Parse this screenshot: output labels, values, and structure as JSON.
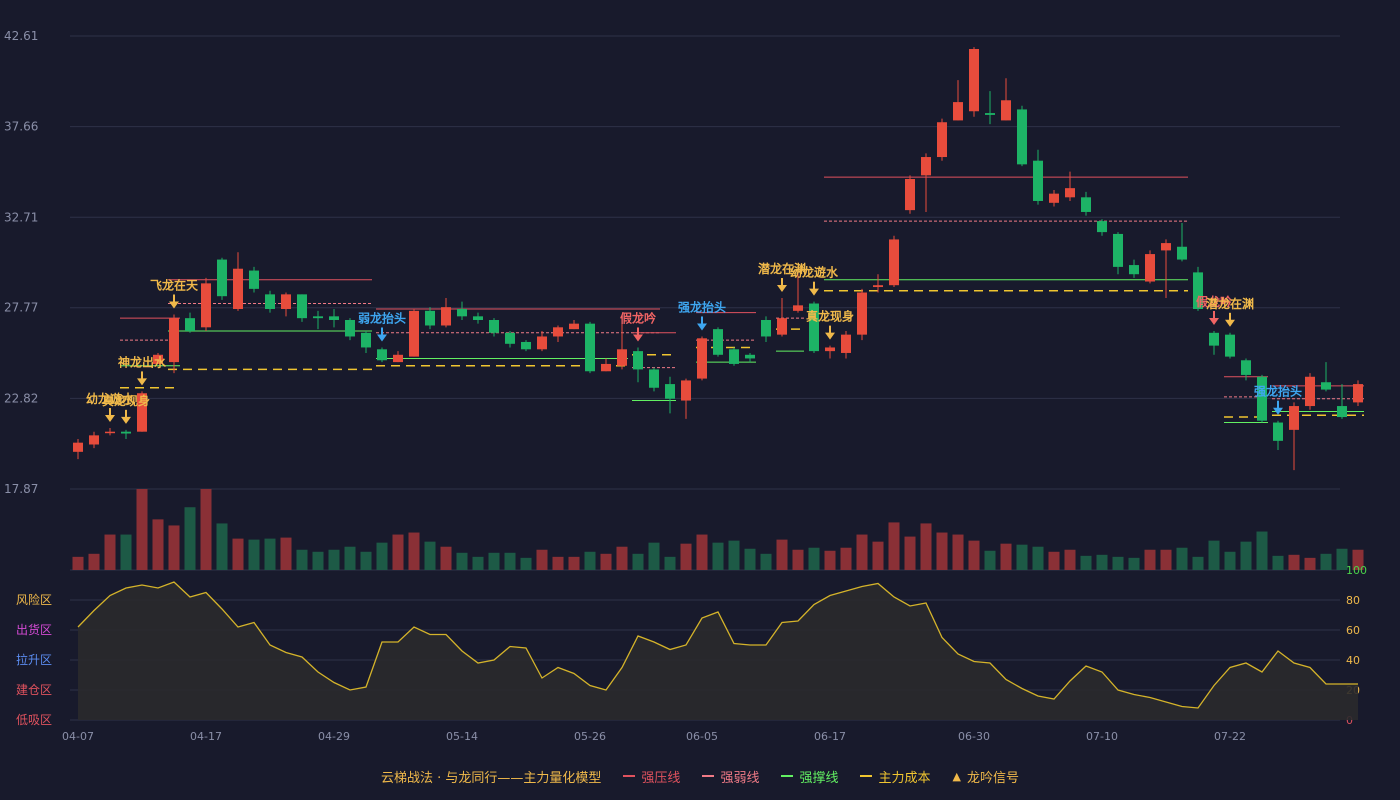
{
  "chart_data": {
    "type": "candlestick",
    "dates": [
      "04-07",
      "04-08",
      "04-09",
      "04-10",
      "04-11",
      "04-14",
      "04-15",
      "04-16",
      "04-17",
      "04-18",
      "04-21",
      "04-22",
      "04-23",
      "04-24",
      "04-25",
      "04-28",
      "04-29",
      "04-30",
      "05-06",
      "05-07",
      "05-08",
      "05-09",
      "05-12",
      "05-13",
      "05-14",
      "05-15",
      "05-16",
      "05-19",
      "05-20",
      "05-21",
      "05-22",
      "05-23",
      "05-26",
      "05-27",
      "05-28",
      "05-29",
      "05-30",
      "06-03",
      "06-04",
      "06-05",
      "06-06",
      "06-09",
      "06-10",
      "06-11",
      "06-12",
      "06-13",
      "06-16",
      "06-17",
      "06-18",
      "06-19",
      "06-20",
      "06-23",
      "06-24",
      "06-25",
      "06-26",
      "06-27",
      "06-30",
      "07-01",
      "07-02",
      "07-03",
      "07-04",
      "07-07",
      "07-08",
      "07-09",
      "07-10",
      "07-11",
      "07-14",
      "07-15",
      "07-16",
      "07-17",
      "07-18",
      "07-21",
      "07-22",
      "07-23",
      "07-24",
      "07-25",
      "07-28",
      "07-29",
      "07-30",
      "07-31",
      "08-01"
    ],
    "x_ticks": [
      "04-07",
      "04-17",
      "04-29",
      "05-14",
      "05-26",
      "06-05",
      "06-17",
      "06-30",
      "07-10",
      "07-22"
    ],
    "price_ticks": [
      "42.61",
      "37.66",
      "32.71",
      "27.77",
      "22.82",
      "17.87"
    ],
    "price_range": [
      17.87,
      42.61
    ],
    "ohlc": [
      [
        19.9,
        20.4,
        19.5,
        20.6
      ],
      [
        20.3,
        20.8,
        20.1,
        21.0
      ],
      [
        21.0,
        21.0,
        20.8,
        21.2
      ],
      [
        21.0,
        20.9,
        20.6,
        21.1
      ],
      [
        21.0,
        23.1,
        21.0,
        23.2
      ],
      [
        24.7,
        25.2,
        24.7,
        25.3
      ],
      [
        24.8,
        27.2,
        24.2,
        27.4
      ],
      [
        27.2,
        26.5,
        26.4,
        27.5
      ],
      [
        26.7,
        29.1,
        26.5,
        29.4
      ],
      [
        30.4,
        28.4,
        28.2,
        30.5
      ],
      [
        27.7,
        29.9,
        27.6,
        30.8
      ],
      [
        29.8,
        28.8,
        28.6,
        30.0
      ],
      [
        28.5,
        27.7,
        27.5,
        28.7
      ],
      [
        27.7,
        28.5,
        27.3,
        28.6
      ],
      [
        28.5,
        27.2,
        27.0,
        28.5
      ],
      [
        27.3,
        27.2,
        26.6,
        27.6
      ],
      [
        27.3,
        27.1,
        26.7,
        27.7
      ],
      [
        27.1,
        26.2,
        26.0,
        27.2
      ],
      [
        26.4,
        25.6,
        25.3,
        26.5
      ],
      [
        25.5,
        24.9,
        24.8,
        25.6
      ],
      [
        24.8,
        25.2,
        24.8,
        25.4
      ],
      [
        25.1,
        27.6,
        25.1,
        27.7
      ],
      [
        27.6,
        26.8,
        26.6,
        27.8
      ],
      [
        26.8,
        27.8,
        26.7,
        28.3
      ],
      [
        27.7,
        27.3,
        27.1,
        28.1
      ],
      [
        27.3,
        27.1,
        26.9,
        27.5
      ],
      [
        27.1,
        26.4,
        26.2,
        27.2
      ],
      [
        26.4,
        25.8,
        25.6,
        26.5
      ],
      [
        25.9,
        25.5,
        25.4,
        26.0
      ],
      [
        25.5,
        26.2,
        25.4,
        26.5
      ],
      [
        26.2,
        26.7,
        25.9,
        26.8
      ],
      [
        26.6,
        26.9,
        26.6,
        27.1
      ],
      [
        26.9,
        24.3,
        24.2,
        27.0
      ],
      [
        24.3,
        24.7,
        24.3,
        25.0
      ],
      [
        24.6,
        25.5,
        24.4,
        27.0
      ],
      [
        25.4,
        24.4,
        23.7,
        25.6
      ],
      [
        24.4,
        23.4,
        23.2,
        24.5
      ],
      [
        23.6,
        22.8,
        22.0,
        24.0
      ],
      [
        22.7,
        23.8,
        21.7,
        23.9
      ],
      [
        23.9,
        26.1,
        23.8,
        26.2
      ],
      [
        26.6,
        25.2,
        25.1,
        26.7
      ],
      [
        25.5,
        24.7,
        24.6,
        25.6
      ],
      [
        25.2,
        25.0,
        24.8,
        25.3
      ],
      [
        27.1,
        26.2,
        25.9,
        27.3
      ],
      [
        26.3,
        27.2,
        26.2,
        28.3
      ],
      [
        27.6,
        27.9,
        27.5,
        29.9
      ],
      [
        28.0,
        25.4,
        25.3,
        28.1
      ],
      [
        25.4,
        25.6,
        25.0,
        25.7
      ],
      [
        25.3,
        26.3,
        25.0,
        26.5
      ],
      [
        26.3,
        28.6,
        26.0,
        28.8
      ],
      [
        28.9,
        29.0,
        28.6,
        29.6
      ],
      [
        29.0,
        31.5,
        28.9,
        31.7
      ],
      [
        33.1,
        34.8,
        32.9,
        35.0
      ],
      [
        35.0,
        36.0,
        33.0,
        36.2
      ],
      [
        36.0,
        37.9,
        35.8,
        38.1
      ],
      [
        38.0,
        39.0,
        38.0,
        40.2
      ],
      [
        38.5,
        41.9,
        38.2,
        42.0
      ],
      [
        38.4,
        38.3,
        37.8,
        39.6
      ],
      [
        38.0,
        39.1,
        38.0,
        40.3
      ],
      [
        38.6,
        35.6,
        35.5,
        38.8
      ],
      [
        35.8,
        33.6,
        33.4,
        36.4
      ],
      [
        33.5,
        34.0,
        33.3,
        34.2
      ],
      [
        33.8,
        34.3,
        33.6,
        35.2
      ],
      [
        33.8,
        33.0,
        32.8,
        34.1
      ],
      [
        32.5,
        31.9,
        31.7,
        32.6
      ],
      [
        31.8,
        30.0,
        29.6,
        31.9
      ],
      [
        30.1,
        29.6,
        29.4,
        30.4
      ],
      [
        29.2,
        30.7,
        29.1,
        30.9
      ],
      [
        30.9,
        31.3,
        28.3,
        31.5
      ],
      [
        31.1,
        30.4,
        30.3,
        32.4
      ],
      [
        29.7,
        27.7,
        27.6,
        30.0
      ],
      [
        26.4,
        25.7,
        25.2,
        26.5
      ],
      [
        26.3,
        25.1,
        25.0,
        26.4
      ],
      [
        24.9,
        24.1,
        23.8,
        25.0
      ],
      [
        24.0,
        21.6,
        21.5,
        24.1
      ],
      [
        21.5,
        20.5,
        20.0,
        21.6
      ],
      [
        21.1,
        22.4,
        18.9,
        22.6
      ],
      [
        22.4,
        24.0,
        22.2,
        24.2
      ],
      [
        23.7,
        23.3,
        23.2,
        24.8
      ],
      [
        22.4,
        21.8,
        21.7,
        23.6
      ],
      [
        22.6,
        23.6,
        22.4,
        23.8
      ]
    ],
    "volume": [
      13,
      16,
      35,
      35,
      80,
      50,
      44,
      62,
      80,
      46,
      31,
      30,
      31,
      32,
      20,
      18,
      20,
      23,
      18,
      27,
      35,
      37,
      28,
      23,
      17,
      13,
      17,
      17,
      12,
      20,
      13,
      13,
      18,
      16,
      23,
      16,
      27,
      13,
      26,
      35,
      27,
      29,
      21,
      16,
      30,
      20,
      22,
      19,
      22,
      35,
      28,
      47,
      33,
      46,
      37,
      35,
      29,
      19,
      26,
      25,
      23,
      18,
      20,
      14,
      15,
      13,
      12,
      20,
      20,
      22,
      13,
      29,
      18,
      28,
      38,
      14,
      15,
      12,
      16,
      21,
      20
    ],
    "osc": [
      62,
      73,
      83,
      88,
      90,
      88,
      92,
      82,
      85,
      74,
      62,
      65,
      50,
      45,
      42,
      32,
      25,
      20,
      22,
      52,
      52,
      62,
      57,
      57,
      46,
      38,
      40,
      49,
      48,
      28,
      35,
      31,
      23,
      20,
      35,
      56,
      52,
      47,
      50,
      68,
      72,
      51,
      50,
      50,
      65,
      66,
      77,
      83,
      86,
      89,
      91,
      82,
      76,
      78,
      55,
      44,
      39,
      38,
      27,
      21,
      16,
      14,
      26,
      36,
      32,
      20,
      17,
      15,
      12,
      9,
      8,
      23,
      35,
      38,
      32,
      46,
      38,
      35,
      24,
      24,
      24
    ],
    "osc_ticks": [
      "100",
      "80",
      "60",
      "40",
      "20",
      "0"
    ],
    "osc_zones": [
      {
        "label": "风险区",
        "color": "#f0b94a",
        "level": 80
      },
      {
        "label": "出货区",
        "color": "#d44ad4",
        "level": 60
      },
      {
        "label": "拉升区",
        "color": "#5b8cf0",
        "level": 40
      },
      {
        "label": "建仓区",
        "color": "#e0525e",
        "level": 20
      },
      {
        "label": "低吸区",
        "color": "#e0525e",
        "level": 0
      }
    ],
    "signals": [
      {
        "label": "幼龙遊水",
        "type": "buy",
        "idx": 2
      },
      {
        "label": "真龙现身",
        "type": "buy",
        "idx": 3
      },
      {
        "label": "神龙出水",
        "type": "buy",
        "idx": 4
      },
      {
        "label": "飞龙在天",
        "type": "buy",
        "idx": 6
      },
      {
        "label": "弱龙抬头",
        "type": "weak",
        "idx": 19
      },
      {
        "label": "假龙吟",
        "type": "fake",
        "idx": 35
      },
      {
        "label": "强龙抬头",
        "type": "strong",
        "idx": 39
      },
      {
        "label": "潜龙在渊",
        "type": "buy",
        "idx": 44
      },
      {
        "label": "幼龙遊水",
        "type": "buy",
        "idx": 46
      },
      {
        "label": "真龙现身",
        "type": "buy",
        "idx": 47
      },
      {
        "label": "假龙吟",
        "type": "fake",
        "idx": 71
      },
      {
        "label": "潜龙在渊",
        "type": "buy",
        "idx": 72
      },
      {
        "label": "强龙抬头",
        "type": "strong",
        "idx": 75
      }
    ],
    "levels": [
      {
        "kind": "pressure",
        "from": 3,
        "to": 6,
        "value": 27.2
      },
      {
        "kind": "weak",
        "from": 3,
        "to": 6,
        "value": 26.0
      },
      {
        "kind": "support",
        "from": 3,
        "to": 6,
        "value": 24.6
      },
      {
        "kind": "cost",
        "from": 3,
        "to": 6,
        "value": 23.4
      },
      {
        "kind": "pressure",
        "from": 6,
        "to": 18,
        "value": 29.3
      },
      {
        "kind": "weak",
        "from": 6,
        "to": 18,
        "value": 28.0
      },
      {
        "kind": "support",
        "from": 6,
        "to": 18,
        "value": 26.5
      },
      {
        "kind": "cost",
        "from": 6,
        "to": 18,
        "value": 24.4
      },
      {
        "kind": "pressure",
        "from": 19,
        "to": 36,
        "value": 27.7
      },
      {
        "kind": "weak",
        "from": 19,
        "to": 36,
        "value": 26.4
      },
      {
        "kind": "support",
        "from": 19,
        "to": 34,
        "value": 25.0
      },
      {
        "kind": "cost",
        "from": 19,
        "to": 34,
        "value": 24.6
      },
      {
        "kind": "pressure",
        "from": 35,
        "to": 37,
        "value": 26.4
      },
      {
        "kind": "weak",
        "from": 35,
        "to": 37,
        "value": 24.5
      },
      {
        "kind": "support",
        "from": 35,
        "to": 37,
        "value": 22.7
      },
      {
        "kind": "cost",
        "from": 35,
        "to": 37,
        "value": 25.2
      },
      {
        "kind": "pressure",
        "from": 39,
        "to": 42,
        "value": 27.5
      },
      {
        "kind": "weak",
        "from": 39,
        "to": 42,
        "value": 26.0
      },
      {
        "kind": "support",
        "from": 39,
        "to": 42,
        "value": 24.8
      },
      {
        "kind": "cost",
        "from": 39,
        "to": 42,
        "value": 25.6
      },
      {
        "kind": "weak",
        "from": 44,
        "to": 45,
        "value": 27.2
      },
      {
        "kind": "cost",
        "from": 44,
        "to": 45,
        "value": 26.6
      },
      {
        "kind": "support",
        "from": 44,
        "to": 45,
        "value": 25.4
      },
      {
        "kind": "pressure",
        "from": 47,
        "to": 69,
        "value": 34.9
      },
      {
        "kind": "weak",
        "from": 47,
        "to": 69,
        "value": 32.5
      },
      {
        "kind": "support",
        "from": 47,
        "to": 69,
        "value": 29.3
      },
      {
        "kind": "cost",
        "from": 47,
        "to": 69,
        "value": 28.7
      },
      {
        "kind": "pressure",
        "from": 72,
        "to": 74,
        "value": 24.0
      },
      {
        "kind": "weak",
        "from": 72,
        "to": 74,
        "value": 22.9
      },
      {
        "kind": "support",
        "from": 72,
        "to": 74,
        "value": 21.5
      },
      {
        "kind": "cost",
        "from": 72,
        "to": 74,
        "value": 21.8
      },
      {
        "kind": "pressure",
        "from": 75,
        "to": 80,
        "value": 23.5
      },
      {
        "kind": "weak",
        "from": 75,
        "to": 80,
        "value": 22.8
      },
      {
        "kind": "support",
        "from": 75,
        "to": 80,
        "value": 22.1
      },
      {
        "kind": "cost",
        "from": 75,
        "to": 80,
        "value": 21.9
      }
    ],
    "legend": {
      "title": "云梯战法 · 与龙同行——主力量化模型",
      "items": [
        {
          "label": "强压线",
          "kind": "pressure"
        },
        {
          "label": "强弱线",
          "kind": "weak"
        },
        {
          "label": "强撑线",
          "kind": "support"
        },
        {
          "label": "主力成本",
          "kind": "cost"
        },
        {
          "label": "龙吟信号",
          "kind": "signal"
        }
      ]
    },
    "colors": {
      "background": "#181a2c",
      "up": "#e74c3c",
      "down": "#1db366",
      "volume_up": "#8a3036",
      "volume_down": "#1d5a46",
      "pressure": "#e0525e",
      "weak": "#f07a86",
      "support": "#62f062",
      "cost": "#f0c530",
      "signal_buy": "#f0b94a",
      "signal_strong": "#3ea6f0",
      "signal_fake": "#f06464",
      "osc_line": "#d4b32a",
      "osc_fill": "#2a2a2c",
      "osc_axis_right": "#4ad44a",
      "grid": "#2e3148",
      "axis_text": "#8a8fa8"
    }
  }
}
